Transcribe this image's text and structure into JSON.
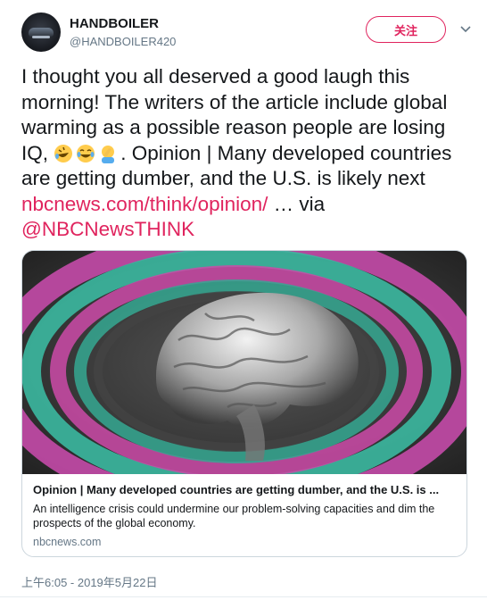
{
  "user": {
    "display_name": "HANDBOILER",
    "handle": "@HANDBOILER420"
  },
  "follow_button_label": "关注",
  "tweet": {
    "text_part1": "I thought you all deserved a good laugh this morning! The writers of the article include global warming as a possible reason people are losing IQ, ",
    "text_part2": ". Opinion | Many developed countries are getting dumber, and the U.S. is likely next ",
    "link1": "nbcnews.com/think/opinion/",
    "ellipsis": " … via ",
    "mention": "@NBCNewsTHINK",
    "emojis": [
      "rofl-emoji",
      "tears-of-joy-emoji",
      "facepalm-emoji"
    ]
  },
  "card": {
    "image": "brain-illustration",
    "title": "Opinion | Many developed countries are getting dumber, and the U.S. is ...",
    "description": "An intelligence crisis could undermine our problem-solving capacities and dim the prospects of the global economy.",
    "domain": "nbcnews.com"
  },
  "timestamp": "上午6:05 - 2019年5月22日",
  "colors": {
    "accent": "#e0245e",
    "secondary_text": "#657786",
    "border": "#ccd6dd"
  }
}
